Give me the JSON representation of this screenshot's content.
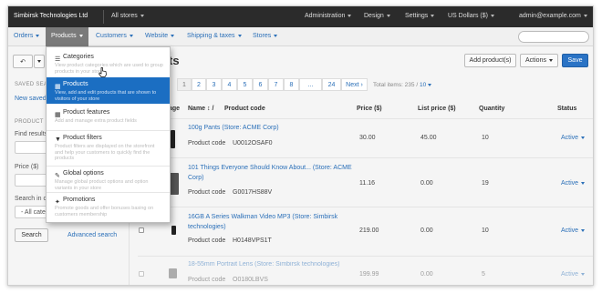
{
  "topbar": {
    "brand": "Simbirsk Technologies Ltd",
    "store_selector": "All stores",
    "administration": "Administration",
    "design": "Design",
    "settings": "Settings",
    "currency": "US Dollars ($)",
    "user": "admin@example.com"
  },
  "nav": {
    "orders": "Orders",
    "products": "Products",
    "customers": "Customers",
    "website": "Website",
    "shipping_taxes": "Shipping & taxes",
    "stores": "Stores"
  },
  "sidebar": {
    "saved_searches_label": "SAVED SEA",
    "new_saved": "New saved",
    "product_label": "PRODUCT",
    "find_results": "Find results",
    "price": "Price ($)",
    "search_in": "Search in c",
    "search_in_value": "- All cate",
    "search_button": "Search",
    "advanced_search": "Advanced search"
  },
  "toolbar": {
    "back_icon": "↶",
    "page_title": "ts",
    "add_product": "Add product(s)",
    "actions": "Actions",
    "save": "Save"
  },
  "pagination": {
    "pages": [
      "1",
      "2",
      "3",
      "4",
      "5",
      "6",
      "7",
      "8",
      "...",
      "24"
    ],
    "next": "Next ›",
    "total_label": "Total items: 235 /",
    "per_page": "10"
  },
  "table": {
    "headers": {
      "image": "age",
      "name": "Name ↕ /",
      "product_code": "Product code",
      "price": "Price ($)",
      "list_price": "List price ($)",
      "quantity": "Quantity",
      "status": "Status"
    },
    "code_label": "Product code",
    "rows": [
      {
        "name": "100g Pants (Store: ACME Corp)",
        "code": "U0012OSAF0",
        "price": "30.00",
        "list_price": "45.00",
        "quantity": "10",
        "status": "Active"
      },
      {
        "name": "101 Things Everyone Should Know About... (Store: ACME Corp)",
        "code": "G0017HS88V",
        "price": "11.16",
        "list_price": "0.00",
        "quantity": "19",
        "status": "Active"
      },
      {
        "name": "16GB A Series Walkman Video MP3 (Store: Simbirsk technologies)",
        "code": "H0148VPS1T",
        "price": "219.00",
        "list_price": "0.00",
        "quantity": "10",
        "status": "Active"
      },
      {
        "name": "18-55mm Portrait Lens (Store: Simbirsk technologies)",
        "code": "O0180LBVS",
        "price": "199.99",
        "list_price": "0.00",
        "quantity": "5",
        "status": "Active"
      }
    ]
  },
  "dropdown": {
    "items": [
      {
        "icon": "☰",
        "title": "Categories",
        "desc": "View product categories which are used to group products in your store"
      },
      {
        "icon": "▦",
        "title": "Products",
        "desc": "View, add and edit products that are shown to visitors of your store"
      },
      {
        "icon": "▦",
        "title": "Product features",
        "desc": "Add and manage extra product fields"
      },
      {
        "icon": "▼",
        "title": "Product filters",
        "desc": "Product filters are displayed on the storefront and help your customers to quickly find the products"
      },
      {
        "icon": "✎",
        "title": "Global options",
        "desc": "Manage global product options and option variants in your store"
      },
      {
        "icon": "✦",
        "title": "Promotions",
        "desc": "Promote goods and offer bonuses basing on customers membership"
      }
    ]
  },
  "colors": {
    "accent": "#2a6fb8",
    "menu_highlight": "#1b6ec2",
    "save_button": "#2a73c5",
    "topbar": "#2b2b2b"
  }
}
